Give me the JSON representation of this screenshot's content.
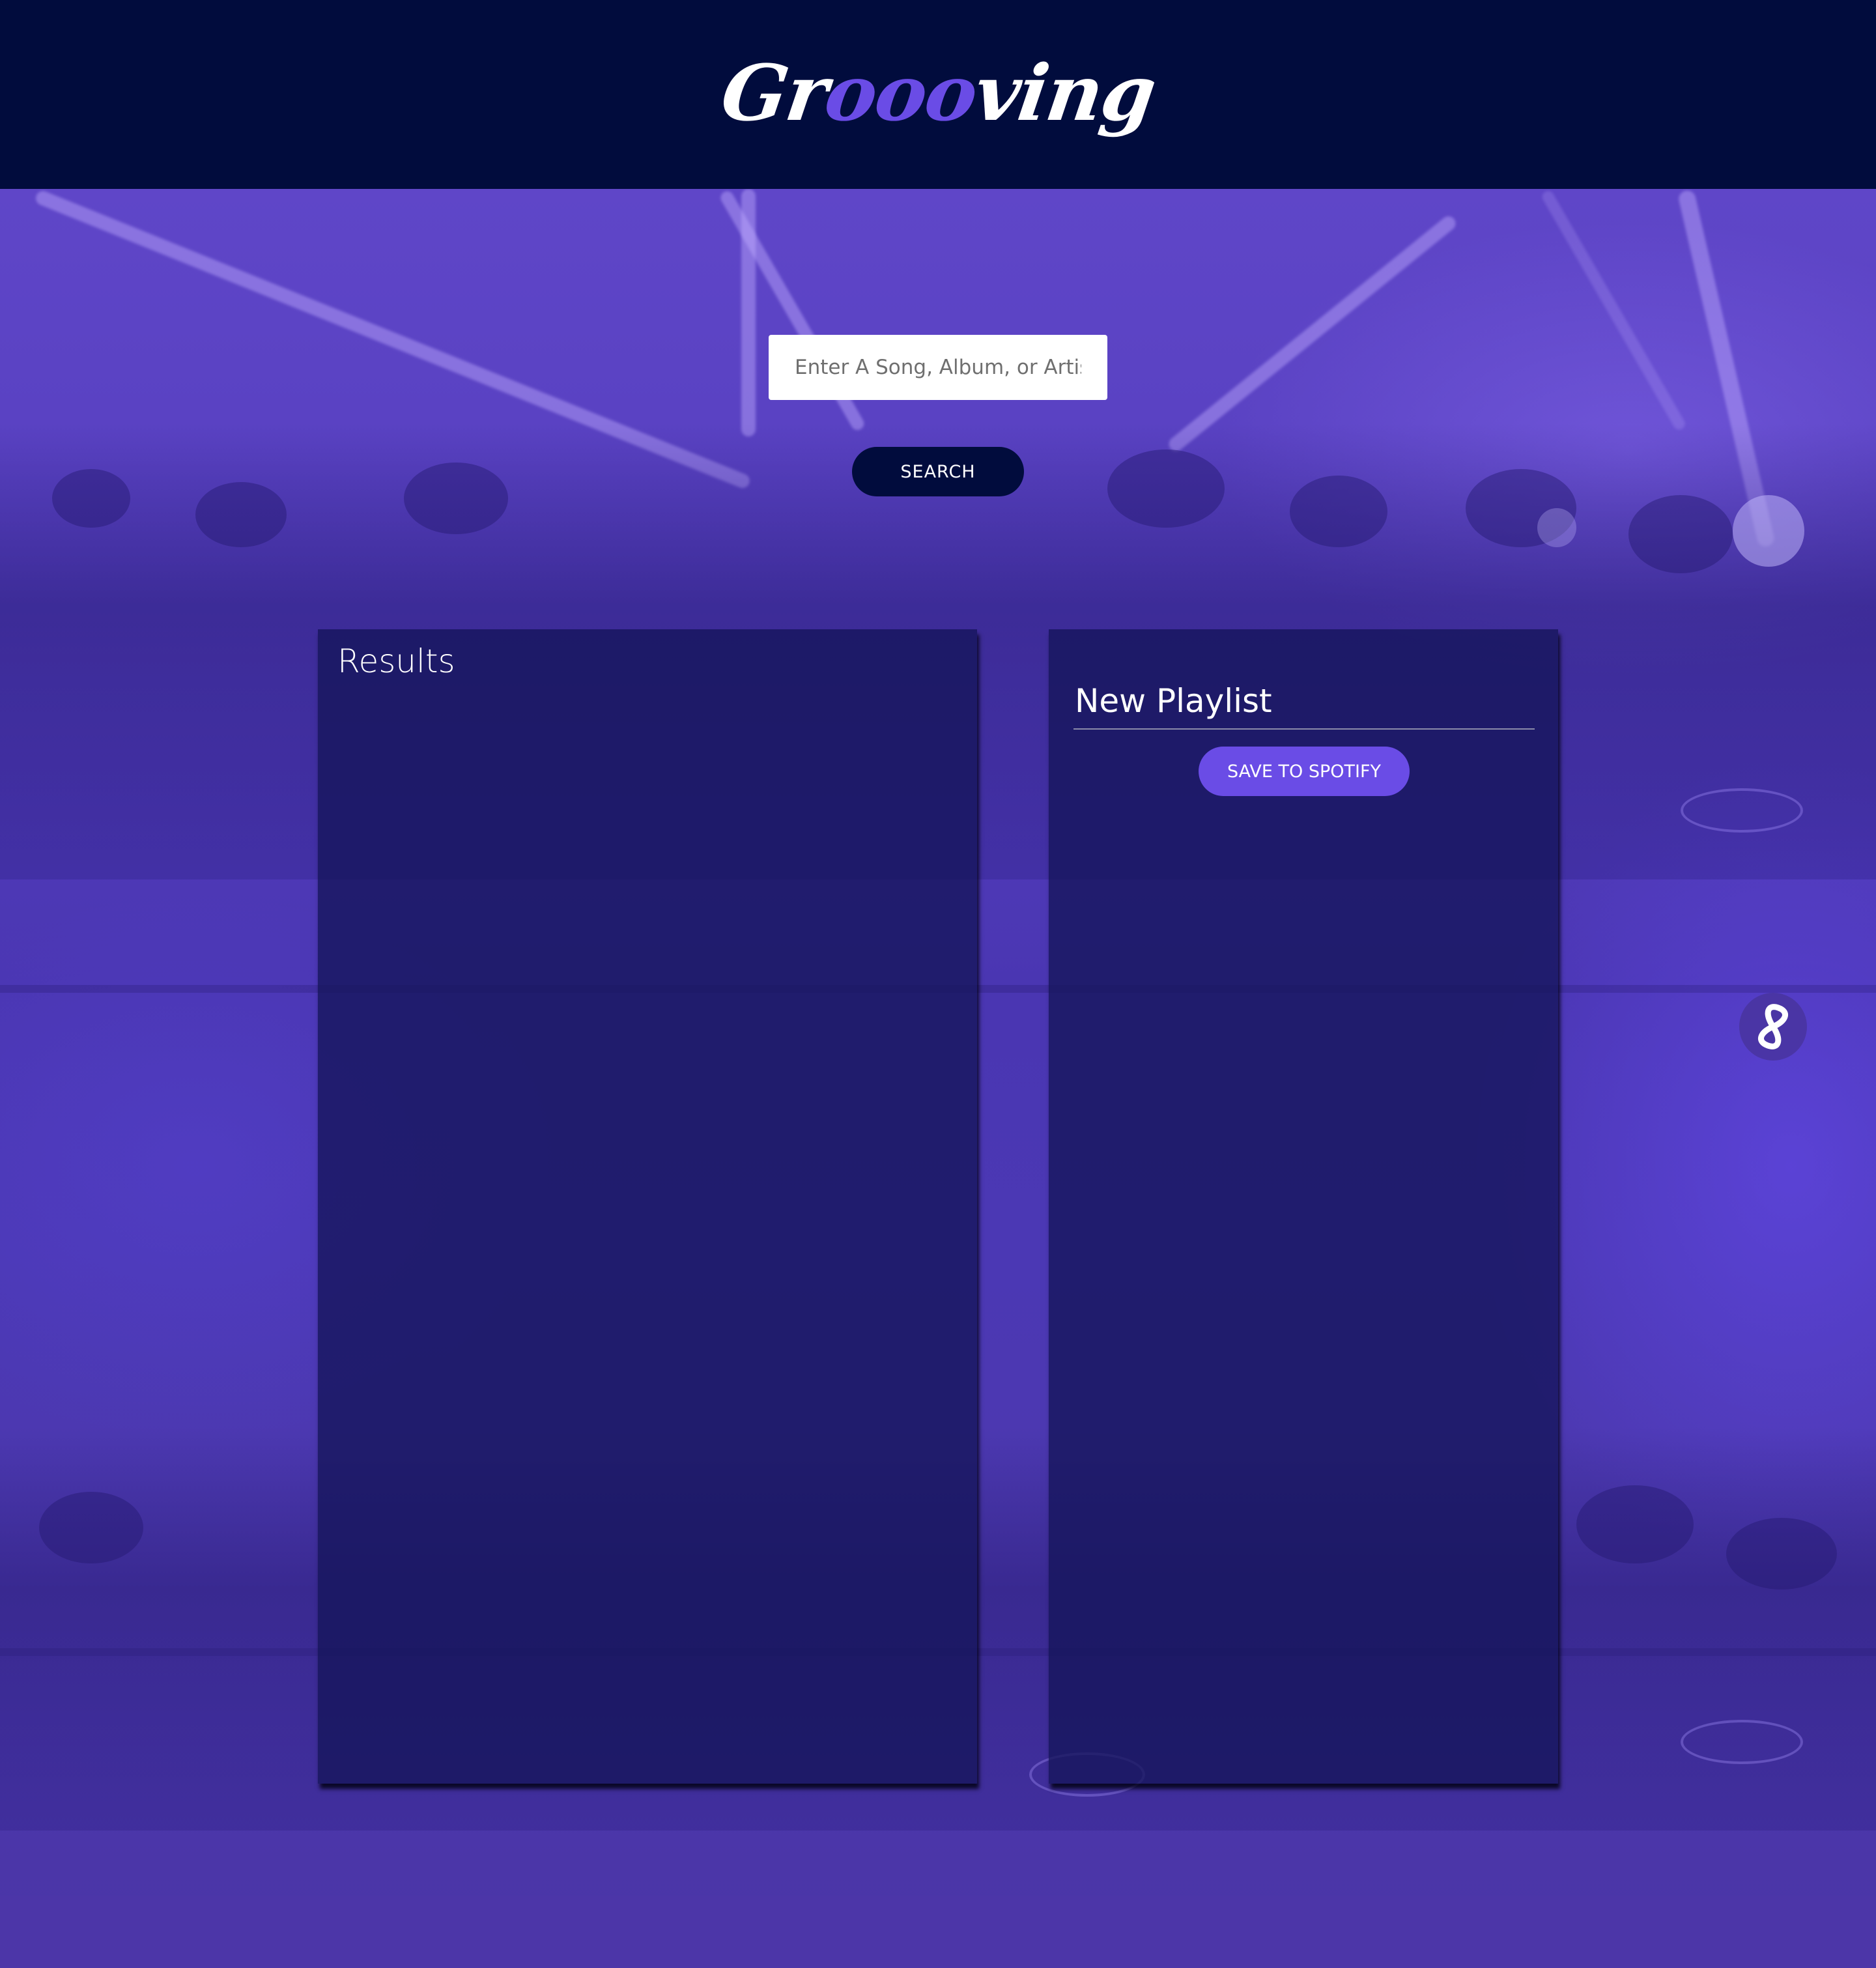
{
  "header": {
    "logo_prefix": "Gr",
    "logo_accent": "ooo",
    "logo_suffix": "ving"
  },
  "search": {
    "placeholder": "Enter A Song, Album, or Artist",
    "value": "",
    "button_label": "SEARCH"
  },
  "results": {
    "title": "Results",
    "tracks": []
  },
  "playlist": {
    "name": "New Playlist",
    "save_label": "SAVE TO SPOTIFY",
    "tracks": []
  },
  "colors": {
    "header_bg": "#010c3d",
    "accent": "#6a4ce6",
    "panel_bg": "#14145a",
    "page_bg": "#4b36a6"
  },
  "floating_button": {
    "icon": "infinity-icon"
  }
}
